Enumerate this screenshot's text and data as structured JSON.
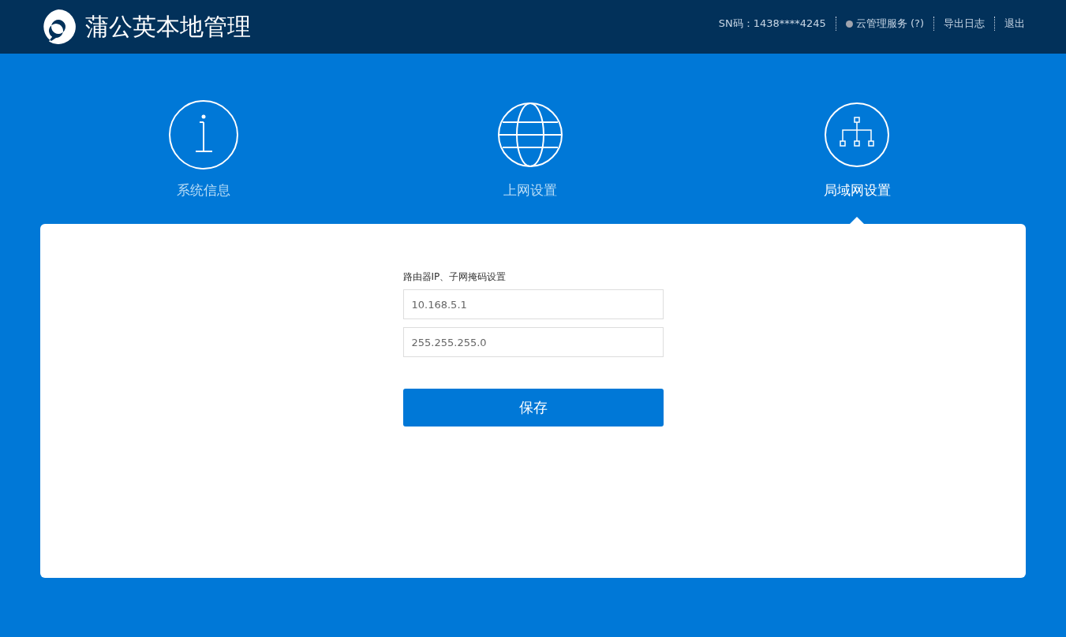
{
  "header": {
    "title": "蒲公英本地管理",
    "sn": "SN码：1438****4245",
    "cloud_service": {
      "label": "云管理服务 (?)",
      "connected": false
    },
    "links": [
      "导出日志",
      "退出"
    ]
  },
  "tabs": [
    {
      "label": "系统信息",
      "kind": "info",
      "selected": false
    },
    {
      "label": "上网设置",
      "kind": "globe",
      "selected": false
    },
    {
      "label": "局域网设置",
      "kind": "network",
      "selected": true
    }
  ],
  "form": {
    "label": "路由器IP、子网掩码设置",
    "fields": [
      {
        "value": "10.168.5.1"
      },
      {
        "value": "255.255.255.0"
      }
    ],
    "button": "保存"
  }
}
